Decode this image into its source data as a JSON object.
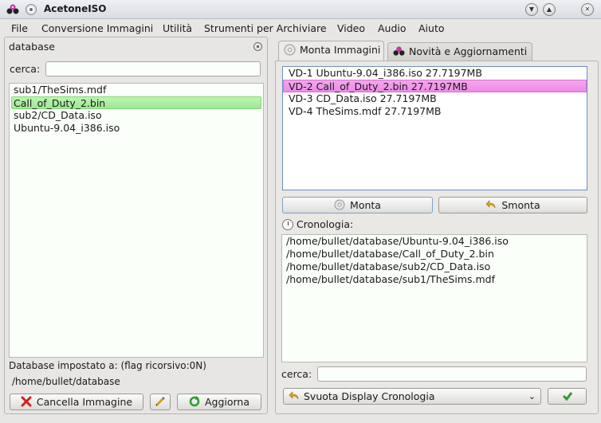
{
  "window": {
    "title": "AcetoneISO"
  },
  "menu": [
    "File",
    "Conversione Immagini",
    "Utilità",
    "Strumenti per Archiviare",
    "Video",
    "Audio",
    "Aiuto"
  ],
  "left_panel": {
    "title": "database",
    "search_label": "cerca:",
    "search_value": "",
    "items": [
      "sub1/TheSims.mdf",
      "Call_of_Duty_2.bin",
      "sub2/CD_Data.iso",
      "Ubuntu-9.04_i386.iso"
    ],
    "selected_index": 1,
    "status_text": "Database impostato a:  (flag ricorsivo:0N)",
    "path_text": "/home/bullet/database",
    "delete_button": "Cancella Immagine",
    "refresh_button": "Aggiorna"
  },
  "tabs": [
    "Monta Immagini",
    "Novità e Aggiornamenti"
  ],
  "active_tab": 0,
  "mount": {
    "devices": [
      "VD-1 Ubuntu-9.04_i386.iso  27.7197MB",
      "VD-2 Call_of_Duty_2.bin  27.7197MB",
      "VD-3 CD_Data.iso  27.7197MB",
      "VD-4 TheSims.mdf  27.7197MB"
    ],
    "selected_index": 1,
    "mount_button": "Monta",
    "unmount_button": "Smonta",
    "history_label": "Cronologia:",
    "history": [
      "/home/bullet/database/Ubuntu-9.04_i386.iso",
      "/home/bullet/database/Call_of_Duty_2.bin",
      "/home/bullet/database/sub2/CD_Data.iso",
      "/home/bullet/database/sub1/TheSims.mdf"
    ],
    "search_label": "cerca:",
    "search_value": "",
    "history_action": "Svuota Display Cronologia"
  },
  "colors": {
    "selected_green": "#a6ec9a",
    "selected_pink": "#ef92e8",
    "focus_blue": "#6d8fc4"
  }
}
